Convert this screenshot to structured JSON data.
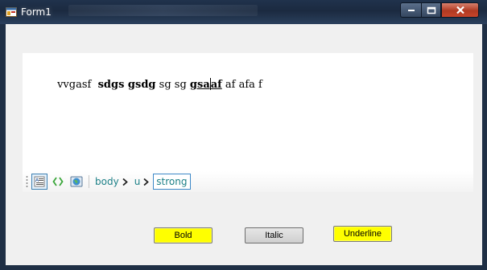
{
  "window": {
    "title": "Form1"
  },
  "editor": {
    "segments": [
      {
        "text": "vvgasf  ",
        "bold": false,
        "underline": false
      },
      {
        "text": "sdgs gsdg",
        "bold": true,
        "underline": false
      },
      {
        "text": " sg sg ",
        "bold": false,
        "underline": false
      },
      {
        "text": "gsa",
        "bold": true,
        "underline": true
      },
      {
        "text": "af",
        "bold": true,
        "underline": true
      },
      {
        "text": " af afa f",
        "bold": false,
        "underline": false
      }
    ]
  },
  "breadcrumb": {
    "items": [
      {
        "label": "body",
        "selected": false
      },
      {
        "label": "u",
        "selected": false
      },
      {
        "label": "strong",
        "selected": true
      }
    ]
  },
  "buttons": {
    "bold": "Bold",
    "italic": "Italic",
    "underline": "Underline"
  },
  "icons": {
    "app": "app-window-icon",
    "design_view": "design-view-icon",
    "source_view": "source-code-icon",
    "preview": "preview-globe-icon"
  },
  "colors": {
    "bold_button_bg": "#ffff00",
    "underline_button_bg": "#ffff00",
    "italic_button_bg": "#d6d6d6",
    "crumb_text": "#1b7f86",
    "titlebar": "#1f2f45",
    "close_button": "#c7442a"
  }
}
